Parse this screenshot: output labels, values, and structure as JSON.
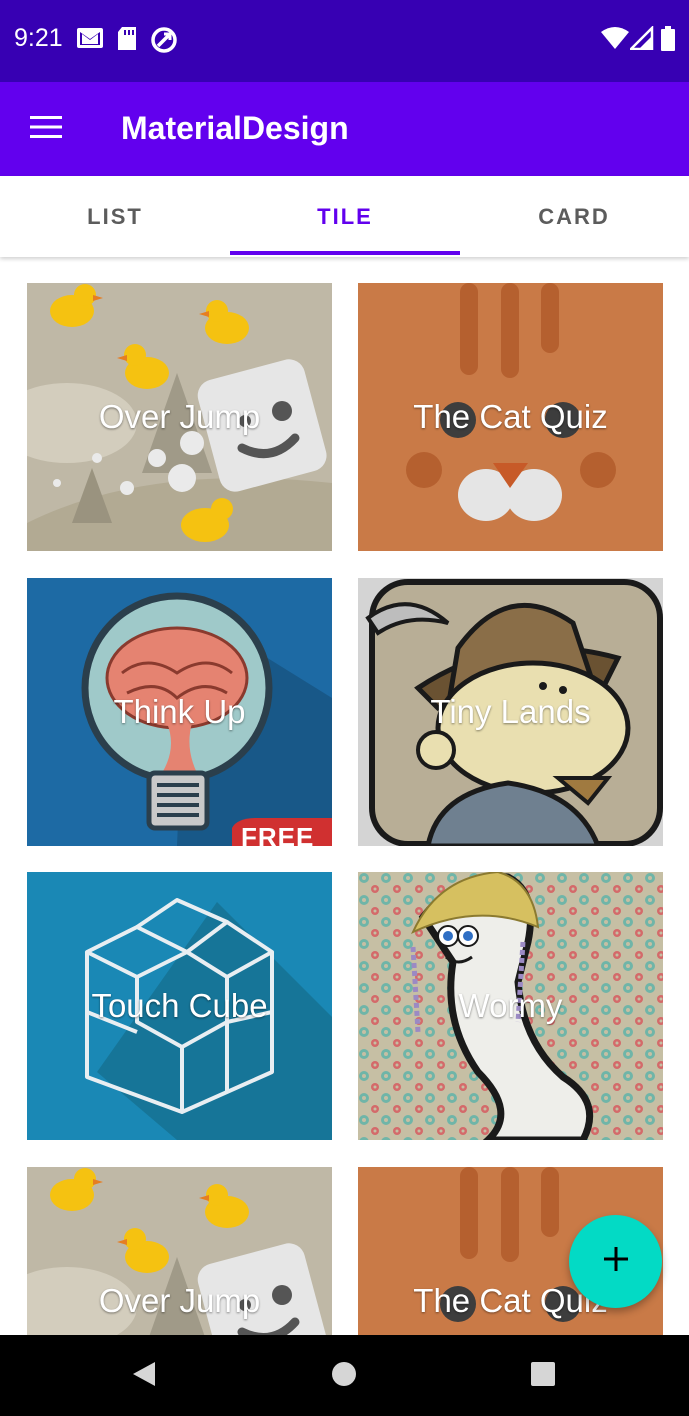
{
  "status_bar": {
    "time": "9:21",
    "icons": [
      "gmail-icon",
      "sd-card-icon",
      "sync-icon",
      "wifi-icon",
      "signal-icon",
      "battery-icon"
    ]
  },
  "app_bar": {
    "title": "MaterialDesign",
    "menu_icon": "menu-icon"
  },
  "tabs": [
    {
      "label": "LIST",
      "active": false
    },
    {
      "label": "TILE",
      "active": true
    },
    {
      "label": "CARD",
      "active": false
    }
  ],
  "tiles": [
    {
      "label": "Over Jump"
    },
    {
      "label": "The Cat Quiz"
    },
    {
      "label": "Think Up"
    },
    {
      "label": "Tiny Lands"
    },
    {
      "label": "Touch Cube"
    },
    {
      "label": "Wormy"
    },
    {
      "label": "Over Jump"
    },
    {
      "label": "The Cat Quiz"
    }
  ],
  "think_up_badge": "FREE",
  "fab": {
    "icon": "add-icon"
  },
  "nav_bar": {
    "icons": [
      "back-icon",
      "home-icon",
      "recents-icon"
    ]
  },
  "colors": {
    "status_bar": "#3700b3",
    "primary": "#6200ee",
    "accent": "#03dac5"
  }
}
